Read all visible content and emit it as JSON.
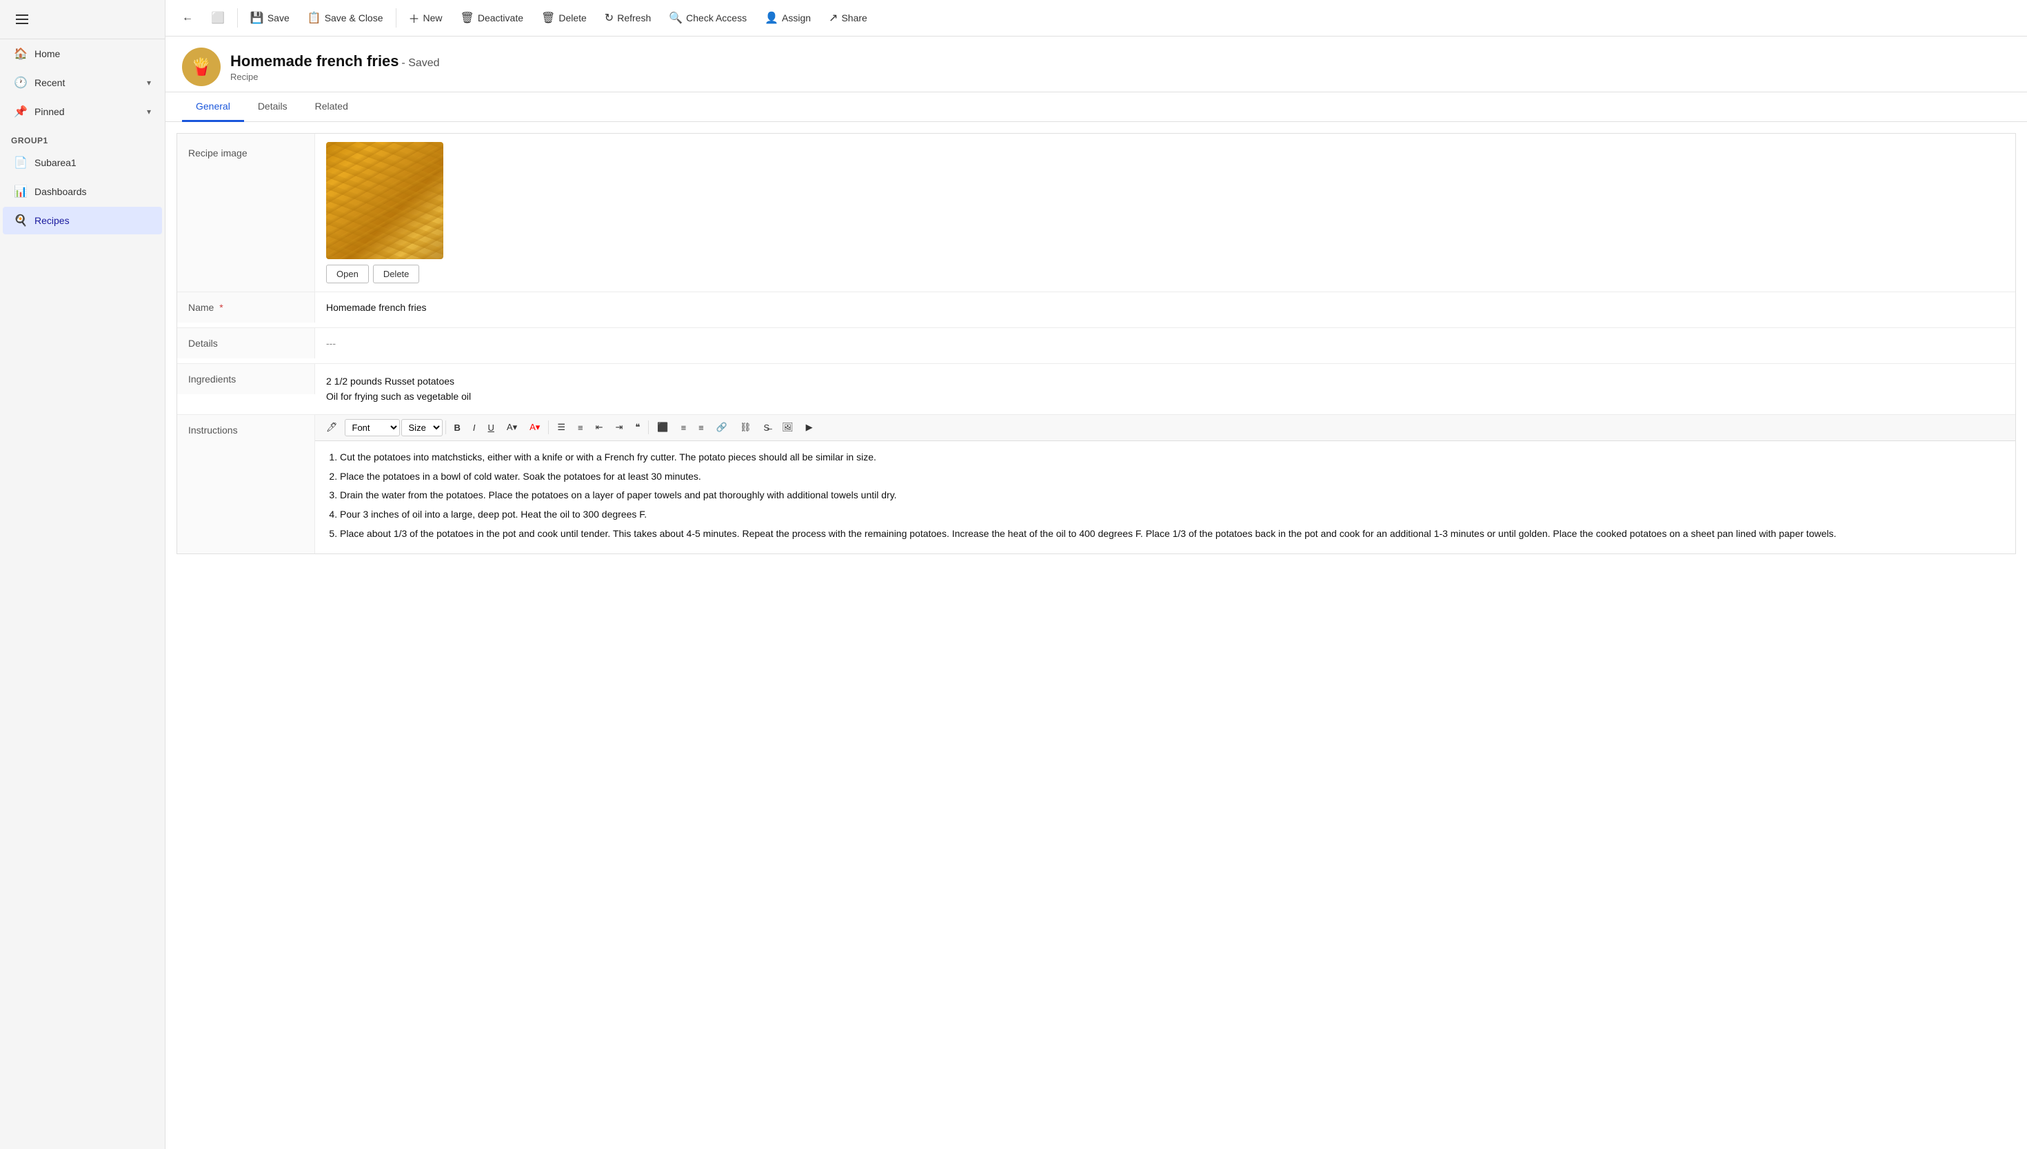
{
  "sidebar": {
    "hamburger_label": "Menu",
    "nav_items": [
      {
        "id": "home",
        "label": "Home",
        "icon": "🏠"
      },
      {
        "id": "recent",
        "label": "Recent",
        "icon": "🕐",
        "expandable": true
      },
      {
        "id": "pinned",
        "label": "Pinned",
        "icon": "📌",
        "expandable": true
      }
    ],
    "section_label": "Group1",
    "group_items": [
      {
        "id": "subarea1",
        "label": "Subarea1",
        "icon": "📄"
      },
      {
        "id": "dashboards",
        "label": "Dashboards",
        "icon": "📊"
      },
      {
        "id": "recipes",
        "label": "Recipes",
        "icon": "🍳",
        "active": true
      }
    ]
  },
  "toolbar": {
    "back_label": "Back",
    "open_label": "Open",
    "save_label": "Save",
    "save_close_label": "Save & Close",
    "new_label": "New",
    "deactivate_label": "Deactivate",
    "delete_label": "Delete",
    "refresh_label": "Refresh",
    "check_access_label": "Check Access",
    "assign_label": "Assign",
    "share_label": "Share"
  },
  "record": {
    "title": "Homemade french fries",
    "status": "- Saved",
    "subtitle": "Recipe"
  },
  "tabs": [
    {
      "id": "general",
      "label": "General",
      "active": true
    },
    {
      "id": "details",
      "label": "Details"
    },
    {
      "id": "related",
      "label": "Related"
    }
  ],
  "form": {
    "image_label": "Recipe image",
    "open_btn": "Open",
    "delete_btn": "Delete",
    "name_label": "Name",
    "name_required": "*",
    "name_value": "Homemade french fries",
    "details_label": "Details",
    "details_value": "---",
    "ingredients_label": "Ingredients",
    "ingredients_line1": "2 1/2 pounds Russet potatoes",
    "ingredients_line2": "Oil for frying such as vegetable oil",
    "instructions_label": "Instructions",
    "instructions_items": [
      "Cut the potatoes into matchsticks, either with a knife or with a French fry cutter. The potato pieces should all be similar in size.",
      "Place the potatoes in a bowl of cold water. Soak the potatoes for at least 30 minutes.",
      "Drain the water from the potatoes. Place the potatoes on a layer of paper towels and pat thoroughly with additional towels until dry.",
      "Pour 3 inches of oil into a large, deep pot. Heat the oil to 300 degrees F.",
      "Place about 1/3 of the potatoes in the pot and cook until tender. This takes about 4-5 minutes. Repeat the process with the remaining potatoes. Increase the heat of the oil to 400 degrees F. Place 1/3 of the potatoes back in the pot and cook for an additional 1-3 minutes or until golden. Place the cooked potatoes on a sheet pan lined with paper towels."
    ]
  },
  "richtext": {
    "font_label": "Font",
    "size_label": "Size",
    "bold_label": "B",
    "italic_label": "I",
    "underline_label": "U"
  }
}
